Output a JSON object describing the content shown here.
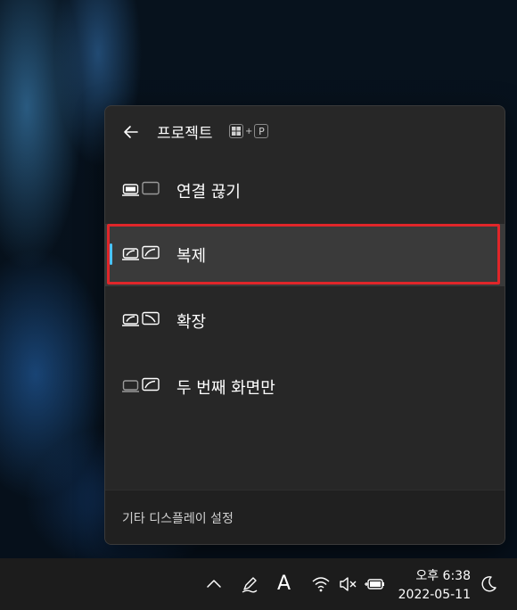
{
  "project_flyout": {
    "title": "프로젝트",
    "shortcut": {
      "modifier_icon": "windows-logo-icon",
      "plus": "+",
      "key": "P"
    },
    "back_icon": "arrow-left-icon",
    "options": [
      {
        "label": "연결 끊기",
        "icon": "pc-screen-only-icon"
      },
      {
        "label": "복제",
        "icon": "duplicate-icon"
      },
      {
        "label": "확장",
        "icon": "extend-icon"
      },
      {
        "label": "두 번째 화면만",
        "icon": "second-screen-only-icon"
      }
    ],
    "selected_option": "복제",
    "footer_link": "기타 디스플레이 설정"
  },
  "colors": {
    "flyout_bg": "#272727",
    "selected_bg": "#3a3a3a",
    "accent": "#4cc2ff",
    "highlight_border": "#e0262a",
    "taskbar_bg": "#1c1c1c"
  },
  "taskbar": {
    "tray_icons": [
      "chevron-up-icon",
      "pen-icon",
      "ime-icon",
      "wifi-icon",
      "speaker-muted-icon",
      "battery-charging-icon",
      "moon-icon"
    ],
    "ime_label": "A",
    "clock": {
      "time": "오후 6:38",
      "date": "2022-05-11"
    }
  }
}
